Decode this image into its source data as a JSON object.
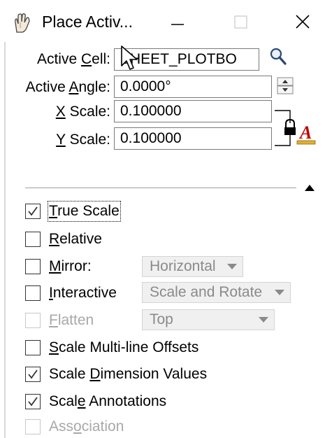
{
  "window": {
    "title": "Place Activ...",
    "icons": {
      "app": "microstation-hand-icon",
      "minimize": "minimize-icon",
      "maximize": "maximize-icon",
      "close": "close-icon"
    }
  },
  "fields": {
    "active_cell": {
      "label": "Active Cell:",
      "value": "SHEET_PLOTBO"
    },
    "active_angle": {
      "label": "Active Angle:",
      "value": "0.0000°"
    },
    "x_scale": {
      "label": "X Scale:",
      "value": "0.100000"
    },
    "y_scale": {
      "label": "Y Scale:",
      "value": "0.100000"
    }
  },
  "icons": {
    "cell_browse": "magnifier-icon",
    "angle_spinner": "spin-updown-icon",
    "scale_lock": "lock-icon",
    "text_style": "text-style-icon",
    "collapse": "triangle-up-icon"
  },
  "options": {
    "true_scale": {
      "label": "True Scale",
      "checked": true
    },
    "relative": {
      "label": "Relative",
      "checked": false
    },
    "mirror": {
      "label": "Mirror:",
      "checked": false,
      "combo_value": "Horizontal"
    },
    "interactive": {
      "label": "Interactive",
      "checked": false,
      "combo_value": "Scale and Rotate"
    },
    "flatten": {
      "label": "Flatten",
      "checked": false,
      "disabled": true,
      "combo_value": "Top"
    },
    "scale_multiline": {
      "label": "Scale Multi-line Offsets",
      "checked": false
    },
    "scale_dimension": {
      "label": "Scale Dimension Values",
      "checked": true
    },
    "scale_annotations": {
      "label": "Scale Annotations",
      "checked": true
    },
    "association": {
      "label": "Association",
      "checked": false,
      "disabled": true
    }
  },
  "colors": {
    "check": "#333333",
    "disabled_text": "#a8a8a8",
    "text_style_icon": "#c00000",
    "text_style_base": "#e0b030"
  }
}
